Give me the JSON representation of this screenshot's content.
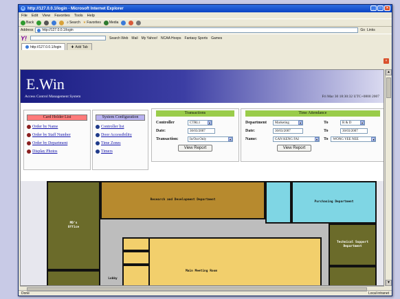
{
  "window": {
    "title": "http://127.0.0.1/login - Microsoft Internet Explorer"
  },
  "menu": [
    "File",
    "Edit",
    "View",
    "Favorites",
    "Tools",
    "Help"
  ],
  "toolbar": {
    "back": "Back",
    "search": "Search",
    "favorites": "Favorites",
    "media": "Media"
  },
  "address": {
    "label": "Address",
    "value": "http://127.0.0.1/login",
    "go": "Go",
    "links": "Links"
  },
  "yahoo": {
    "logo": "Y!",
    "search_web": "Search Web",
    "mail": "Mail",
    "my_yahoo": "My Yahoo!",
    "ncaa": "NCAA Hoops",
    "fantasy": "Fantasy Sports",
    "games": "Games"
  },
  "tabs": {
    "current": "http://127.0.0.1/login",
    "add": "Add Tab"
  },
  "page": {
    "app_title": "E.Win",
    "app_subtitle": "Access Control Management System",
    "datetime": "Fri Mar 30 18:30:32 UTC+0800 2007",
    "card_holder": {
      "header": "Card Holder List",
      "links": [
        "Order by Name",
        "Order by Staff Number",
        "Order by Department",
        "Display Photos"
      ]
    },
    "system_config": {
      "header": "System Configuration",
      "links": [
        "Controller list",
        "Door Accessibility",
        "Time Zones",
        "Timers"
      ]
    },
    "transactions": {
      "header": "Transactions",
      "controller_label": "Controller",
      "controller_value": "CTRL1",
      "date_label": "Date:",
      "date_value": "30/03/2007",
      "transaction_label": "Transaction:",
      "transaction_value": "In/Out Only",
      "button": "View Report"
    },
    "time_attendance": {
      "header": "Time Attendance",
      "dept_label": "Department",
      "dept_value": "Marketing",
      "to_label": "To",
      "to_dept_value": "R & D",
      "date_label": "Date:",
      "date_from": "30/03/2007",
      "date_to": "30/03/2007",
      "name_label": "Name:",
      "name_from": "GAN KENG FAI",
      "name_to": "WONG YEE NEE",
      "button": "View Report"
    },
    "floor_plan": {
      "rnd": "Research and Development Department",
      "purchasing": "Purchasing Department",
      "md": "MD's Office",
      "technical": "Technical Support Department",
      "lobby": "Lobby",
      "meeting": "Main Meeting Room"
    }
  },
  "status": {
    "left": "Done",
    "right": "Local intranet"
  },
  "colors": {
    "titlebar": "#0a43c4",
    "banner": "#1a1d82",
    "card_holder_head": "#ff7b7b",
    "sysconfig_head": "#b9b2f0",
    "green_head": "#9acc4a",
    "rnd": "#b78a2e",
    "cyan": "#7fd6e4",
    "olive": "#6b6b2a",
    "yellow": "#f2cf6c",
    "grey": "#bdbdbd"
  }
}
